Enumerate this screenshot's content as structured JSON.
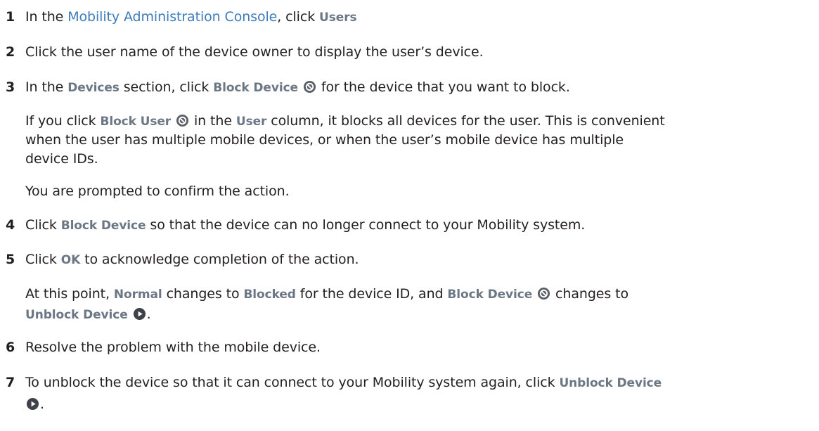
{
  "steps": [
    {
      "num": "1",
      "pre": "In the ",
      "link": "Mobility Administration Console",
      "mid": ", click ",
      "ui": "Users"
    },
    {
      "num": "2",
      "text": "Click the user name of the device owner to display the user’s device."
    },
    {
      "num": "3",
      "pre": "In the ",
      "ui1": "Devices",
      "mid": " section, click ",
      "ui2": "Block Device",
      "post": " for the device that you want to block.",
      "icon": "block-icon"
    },
    {
      "num": "4",
      "pre": "Click ",
      "ui": "Block Device",
      "post": " so that the device can no longer connect to your Mobility system."
    },
    {
      "num": "5",
      "pre": "Click ",
      "ui": "OK",
      "post": " to acknowledge completion of the action."
    },
    {
      "num": "6",
      "text": "Resolve the problem with the mobile device."
    },
    {
      "num": "7",
      "line1": "To unblock the device so that it can connect to your Mobility system again, click ",
      "ui": "Unblock Device",
      "post": ".",
      "icon": "unblock-icon"
    }
  ],
  "notes": {
    "block_user": {
      "pre": "If you click ",
      "ui1": "Block User",
      "mid": " in the ",
      "ui2": "User",
      "line1_end": " column, it blocks all devices for the user. This is convenient",
      "line2": "when the user has multiple mobile devices, or when the user’s mobile device has multiple",
      "line3": "device IDs."
    },
    "prompt": "You are prompted to confirm the action.",
    "status_change": {
      "pre": "At this point, ",
      "ui1": "Normal",
      "mid1": " changes to ",
      "ui2": "Blocked",
      "mid2": " for the device ID, and ",
      "ui3": "Block Device",
      "mid3": " changes to",
      "ui4": "Unblock Device",
      "post": "."
    }
  },
  "colors": {
    "text": "#231f20",
    "ui_term": "#6b7784",
    "link": "#3d7bbd",
    "icon": "#5a5f66"
  }
}
